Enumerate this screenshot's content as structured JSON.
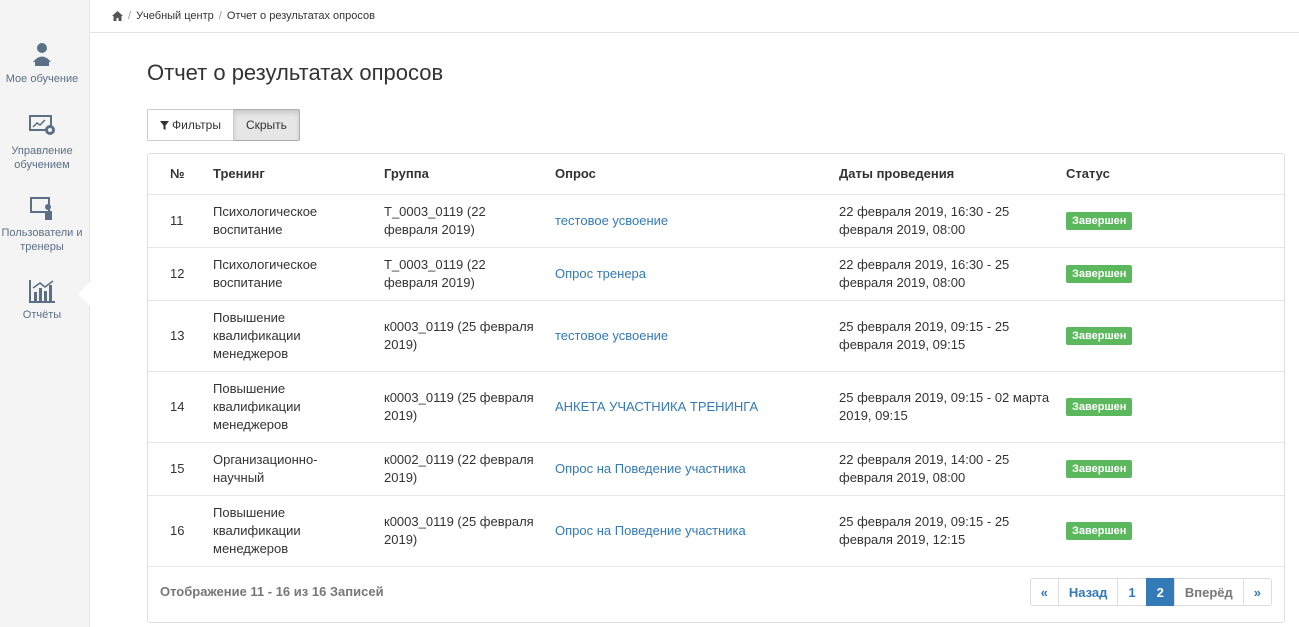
{
  "sidebar": {
    "items": [
      {
        "label": "Мое обучение",
        "icon": "user-learning-icon"
      },
      {
        "label": "Управление обучением",
        "icon": "presentation-gear-icon"
      },
      {
        "label": "Пользователи и тренеры",
        "icon": "trainer-board-icon"
      },
      {
        "label": "Отчёты",
        "icon": "chart-icon"
      }
    ]
  },
  "breadcrumb": {
    "home_icon": "home-icon",
    "items": [
      "Учебный центр",
      "Отчет о результатах опросов"
    ]
  },
  "page": {
    "title": "Отчет о результатах опросов"
  },
  "toolbar": {
    "filters_label": "Фильтры",
    "hide_label": "Скрыть"
  },
  "table": {
    "headers": [
      "№",
      "Тренинг",
      "Группа",
      "Опрос",
      "Даты проведения",
      "Статус"
    ],
    "rows": [
      {
        "num": "11",
        "training": "Психологическое воспитание",
        "group": "Т_0003_0119 (22 февраля 2019)",
        "survey": "тестовое усвоение",
        "dates": "22 февраля 2019, 16:30 - 25 февраля 2019, 08:00",
        "status": "Завершен"
      },
      {
        "num": "12",
        "training": "Психологическое воспитание",
        "group": "Т_0003_0119 (22 февраля 2019)",
        "survey": "Опрос тренера",
        "dates": "22 февраля 2019, 16:30 - 25 февраля 2019, 08:00",
        "status": "Завершен"
      },
      {
        "num": "13",
        "training": "Повышение квалификации менеджеров",
        "group": "к0003_0119 (25 февраля 2019)",
        "survey": "тестовое усвоение",
        "dates": "25 февраля 2019, 09:15 - 25 февраля 2019, 09:15",
        "status": "Завершен"
      },
      {
        "num": "14",
        "training": "Повышение квалификации менеджеров",
        "group": "к0003_0119 (25 февраля 2019)",
        "survey": "АНКЕТА УЧАСТНИКА ТРЕНИНГА",
        "dates": "25 февраля 2019, 09:15 - 02 марта 2019, 09:15",
        "status": "Завершен"
      },
      {
        "num": "15",
        "training": "Организационно-научный",
        "group": "к0002_0119 (22 февраля 2019)",
        "survey": "Опрос на Поведение участника",
        "dates": "22 февраля 2019, 14:00 - 25 февраля 2019, 08:00",
        "status": "Завершен"
      },
      {
        "num": "16",
        "training": "Повышение квалификации менеджеров",
        "group": "к0003_0119 (25 февраля 2019)",
        "survey": "Опрос на Поведение участника",
        "dates": "25 февраля 2019, 09:15 - 25 февраля 2019, 12:15",
        "status": "Завершен"
      }
    ]
  },
  "footer": {
    "info": "Отображение 11 - 16 из 16 Записей"
  },
  "pagination": {
    "first": "«",
    "prev": "Назад",
    "p1": "1",
    "p2": "2",
    "next": "Вперёд",
    "last": "»"
  },
  "colors": {
    "accent": "#337ab7",
    "success": "#5cb85c"
  }
}
